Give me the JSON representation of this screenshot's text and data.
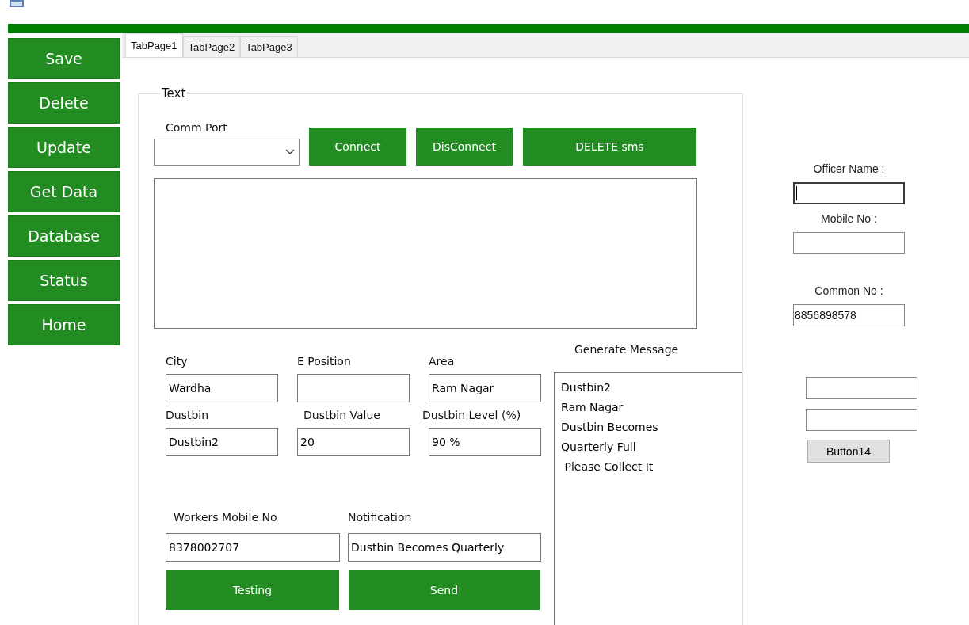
{
  "sidebar": {
    "buttons": [
      "Save",
      "Delete",
      "Update",
      "Get Data",
      "Database",
      "Status",
      "Home"
    ]
  },
  "tabs": [
    {
      "label": "TabPage1",
      "selected": true
    },
    {
      "label": "TabPage2",
      "selected": false
    },
    {
      "label": "TabPage3",
      "selected": false
    }
  ],
  "group": {
    "title": "Text",
    "comm_port": {
      "label": "Comm Port"
    },
    "buttons": [
      "Connect",
      "DisConnect",
      "DELETE sms"
    ],
    "fields": [
      {
        "label": "City",
        "value": "Wardha"
      },
      {
        "label": "E Position"
      },
      {
        "label": "Area",
        "value": "Ram Nagar"
      },
      {
        "label": "Dustbin",
        "value": "Dustbin2"
      },
      {
        "label": "Dustbin Value",
        "value": "20"
      },
      {
        "label": "Dustbin Level (%)",
        "value": "90 %"
      }
    ],
    "workers_mobile": {
      "label": "Workers Mobile No",
      "value": "8378002707"
    },
    "notification": {
      "label": "Notification",
      "value": "Dustbin Becomes Quarterly"
    },
    "generate_message": {
      "label": "Generate Message",
      "lines": [
        "Dustbin2",
        "Ram Nagar",
        "Dustbin Becomes",
        "Quarterly Full",
        " Please Collect It"
      ]
    },
    "actions": [
      "Testing",
      "Send"
    ]
  },
  "right_panel": {
    "fields": [
      {
        "label": "Officer Name :",
        "focused": true
      },
      {
        "label": "Mobile No :",
        "focused": false
      },
      {
        "label": "Common No :",
        "value": "8856898578",
        "focused": false
      }
    ],
    "button": "Button14"
  }
}
